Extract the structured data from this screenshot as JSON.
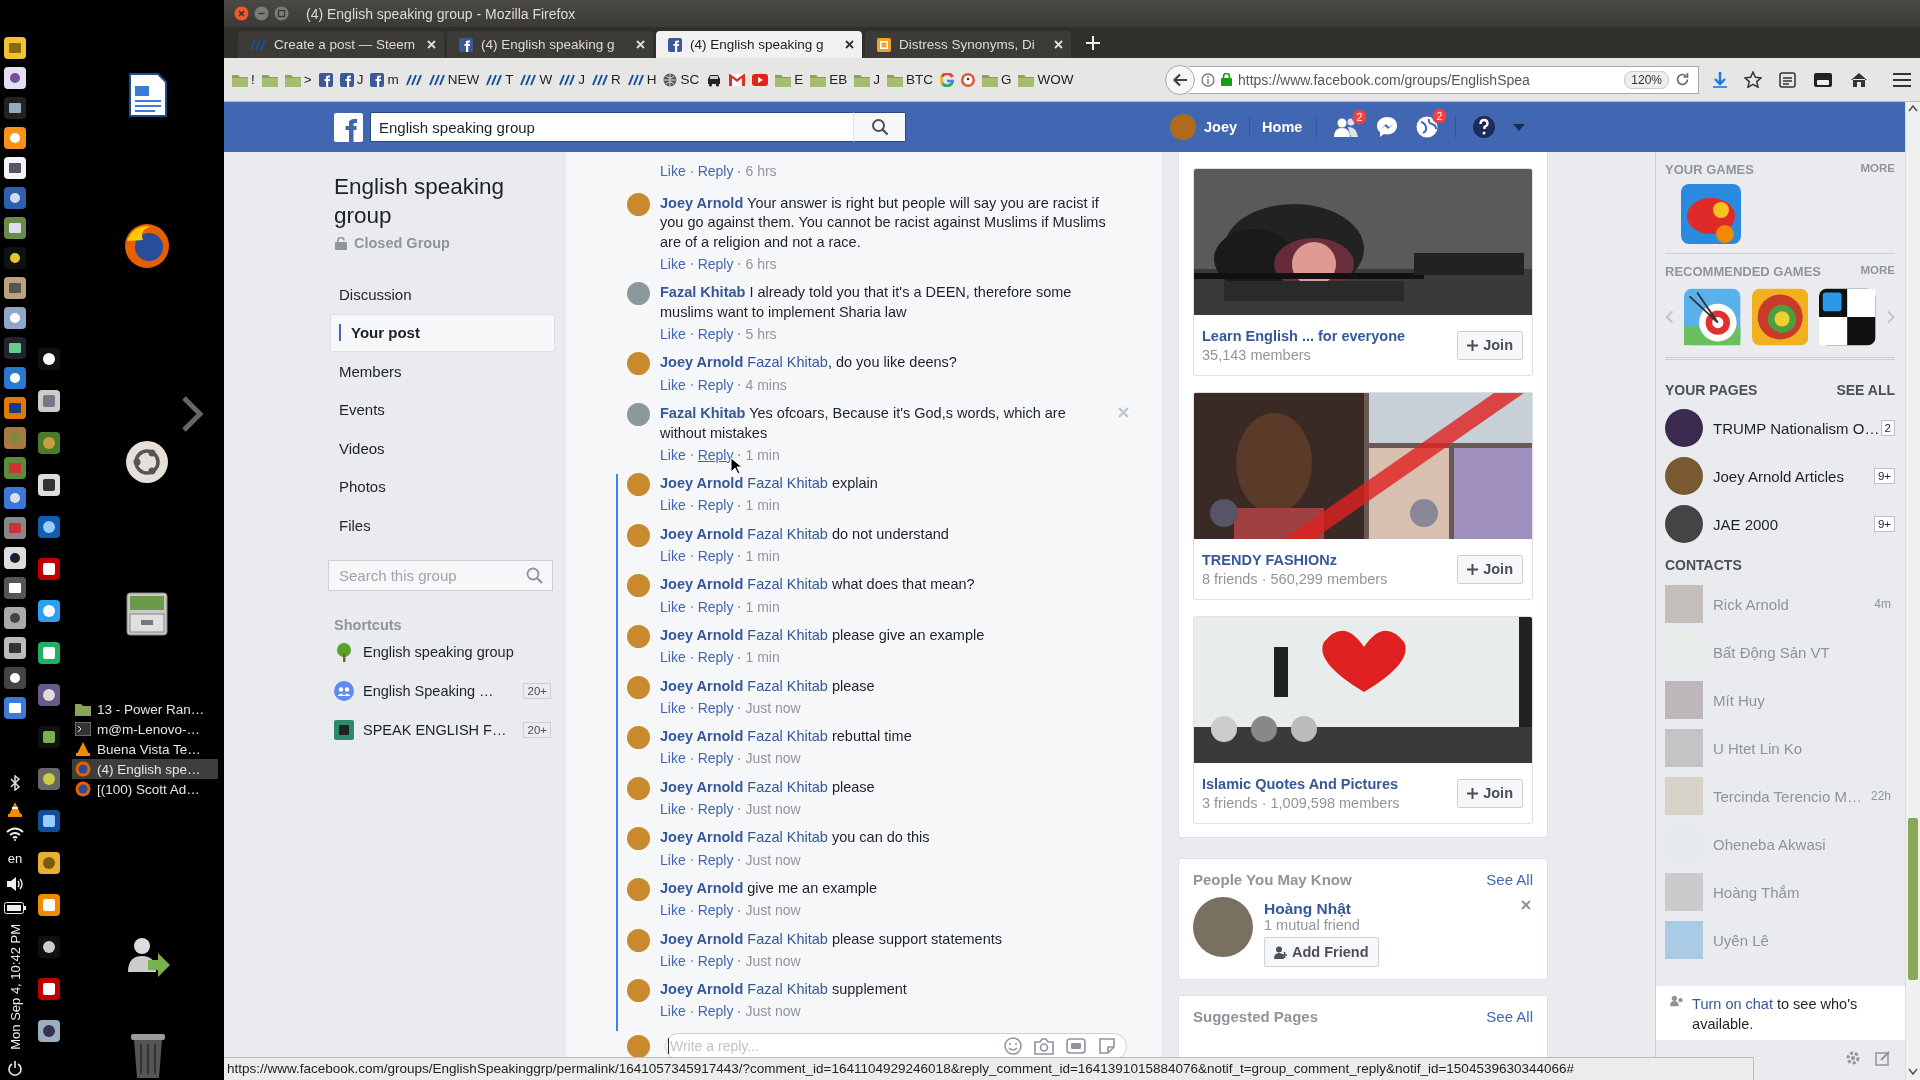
{
  "desktop": {
    "window_list": [
      {
        "title": "13 - Power Ran…",
        "kind": "folder",
        "selected": false
      },
      {
        "title": "m@m-Lenovo-…",
        "kind": "terminal",
        "selected": false
      },
      {
        "title": "Buena Vista Te…",
        "kind": "cone",
        "selected": false
      },
      {
        "title": "(4) English spe…",
        "kind": "firefox",
        "selected": true
      },
      {
        "title": "[(100) Scott Ad…",
        "kind": "firefox",
        "selected": false
      }
    ],
    "keyboard_layout": "en",
    "clock": "Mon Sep 4, 10:42 PM"
  },
  "window": {
    "title": "(4) English speaking group - Mozilla Firefox"
  },
  "tabs": [
    {
      "label": "Create a post — Steem",
      "kind": "steem",
      "selected": false
    },
    {
      "label": "(4) English speaking g",
      "kind": "facebook",
      "selected": false
    },
    {
      "label": "(4) English speaking g",
      "kind": "facebook",
      "selected": true
    },
    {
      "label": "Distress Synonyms, Di",
      "kind": "thesaurus",
      "selected": false
    }
  ],
  "bookmarks": [
    {
      "kind": "folder",
      "label": "!"
    },
    {
      "kind": "folder"
    },
    {
      "kind": "folder",
      "label": ">"
    },
    {
      "kind": "facebook"
    },
    {
      "kind": "facebook",
      "label": "J"
    },
    {
      "kind": "facebook",
      "label": "m"
    },
    {
      "kind": "steem"
    },
    {
      "kind": "steem",
      "label": "NEW"
    },
    {
      "kind": "steem",
      "label": "T"
    },
    {
      "kind": "steem",
      "label": "W"
    },
    {
      "kind": "steem",
      "label": "J"
    },
    {
      "kind": "steem",
      "label": "R"
    },
    {
      "kind": "steem",
      "label": "H"
    },
    {
      "kind": "globe",
      "label": "SC"
    },
    {
      "kind": "car"
    },
    {
      "kind": "mail"
    },
    {
      "kind": "video"
    },
    {
      "kind": "folder",
      "label": "E"
    },
    {
      "kind": "folder",
      "label": "EB"
    },
    {
      "kind": "folder",
      "label": "J"
    },
    {
      "kind": "folder",
      "label": "BTC"
    },
    {
      "kind": "ring"
    },
    {
      "kind": "duck"
    },
    {
      "kind": "folder",
      "label": "G"
    },
    {
      "kind": "folder",
      "label": "WOW"
    }
  ],
  "address_bar": {
    "url": "https://www.facebook.com/groups/EnglishSpea",
    "zoom": "120%"
  },
  "facebook_bar": {
    "search_value": "English speaking group",
    "user": "Joey",
    "home": "Home",
    "friend_requests": "2",
    "notifications": "2"
  },
  "group_nav": {
    "title": "English speaking group",
    "privacy": "Closed Group",
    "items": [
      {
        "label": "Discussion",
        "selected": false
      },
      {
        "label": "Your post",
        "selected": true
      },
      {
        "label": "Members",
        "selected": false
      },
      {
        "label": "Events",
        "selected": false
      },
      {
        "label": "Videos",
        "selected": false
      },
      {
        "label": "Photos",
        "selected": false
      },
      {
        "label": "Files",
        "selected": false
      }
    ],
    "search_placeholder": "Search this group",
    "shortcuts_title": "Shortcuts",
    "shortcuts": [
      {
        "label": "English speaking group",
        "kind": "tree"
      },
      {
        "label": "English Speaking …",
        "kind": "group",
        "badge": "20+"
      },
      {
        "label": "SPEAK ENGLISH F…",
        "kind": "chip",
        "badge": "20+"
      }
    ]
  },
  "comments": [
    {
      "like": "Like",
      "reply": "Reply",
      "time": "6 hrs",
      "new": false,
      "hovered": false
    },
    {
      "author": "Joey Arnold",
      "color": "#c98a2e",
      "text": "Your answer is right but people will say you are racist if you go against them. You cannot be racist against Muslims if Muslims are of a religion and not a race.",
      "like": "Like",
      "reply": "Reply",
      "time": "6 hrs",
      "new": false,
      "hovered": false
    },
    {
      "author": "Fazal Khitab",
      "color": "#8c989c",
      "text": "I already told you that it's a DEEN, therefore some muslims want to implement Sharia law",
      "like": "Like",
      "reply": "Reply",
      "time": "5 hrs",
      "new": false,
      "hovered": false
    },
    {
      "author": "Joey Arnold",
      "color": "#c98a2e",
      "mention": "Fazal Khitab",
      "text": ", do you like deens?",
      "like": "Like",
      "reply": "Reply",
      "time": "4 mins",
      "new": false,
      "hovered": false
    },
    {
      "author": "Fazal Khitab",
      "color": "#8c989c",
      "text": "Yes ofcoars, Because it's God,s words, which are without mistakes",
      "like": "Like",
      "reply": "Reply",
      "time": "1 min",
      "new": false,
      "hovered": true
    },
    {
      "author": "Joey Arnold",
      "color": "#c98a2e",
      "mention": "Fazal Khitab",
      "text": "explain",
      "like": "Like",
      "reply": "Reply",
      "time": "1 min",
      "new": true,
      "hovered": false
    },
    {
      "author": "Joey Arnold",
      "color": "#c98a2e",
      "mention": "Fazal Khitab",
      "text": "do not understand",
      "like": "Like",
      "reply": "Reply",
      "time": "1 min",
      "new": true,
      "hovered": false
    },
    {
      "author": "Joey Arnold",
      "color": "#c98a2e",
      "mention": "Fazal Khitab",
      "text": "what does that mean?",
      "like": "Like",
      "reply": "Reply",
      "time": "1 min",
      "new": true,
      "hovered": false
    },
    {
      "author": "Joey Arnold",
      "color": "#c98a2e",
      "mention": "Fazal Khitab",
      "text": "please give an example",
      "like": "Like",
      "reply": "Reply",
      "time": "1 min",
      "new": true,
      "hovered": false
    },
    {
      "author": "Joey Arnold",
      "color": "#c98a2e",
      "mention": "Fazal Khitab",
      "text": "please",
      "like": "Like",
      "reply": "Reply",
      "time": "Just now",
      "new": true,
      "hovered": false
    },
    {
      "author": "Joey Arnold",
      "color": "#c98a2e",
      "mention": "Fazal Khitab",
      "text": "rebuttal time",
      "like": "Like",
      "reply": "Reply",
      "time": "Just now",
      "new": true,
      "hovered": false
    },
    {
      "author": "Joey Arnold",
      "color": "#c98a2e",
      "mention": "Fazal Khitab",
      "text": "please",
      "like": "Like",
      "reply": "Reply",
      "time": "Just now",
      "new": true,
      "hovered": false
    },
    {
      "author": "Joey Arnold",
      "color": "#c98a2e",
      "mention": "Fazal Khitab",
      "text": "you can do this",
      "like": "Like",
      "reply": "Reply",
      "time": "Just now",
      "new": true,
      "hovered": false
    },
    {
      "author": "Joey Arnold",
      "color": "#c98a2e",
      "text": "give me an example",
      "like": "Like",
      "reply": "Reply",
      "time": "Just now",
      "new": true,
      "hovered": false
    },
    {
      "author": "Joey Arnold",
      "color": "#c98a2e",
      "mention": "Fazal Khitab",
      "text": "please support statements",
      "like": "Like",
      "reply": "Reply",
      "time": "Just now",
      "new": true,
      "hovered": false
    },
    {
      "author": "Joey Arnold",
      "color": "#c98a2e",
      "mention": "Fazal Khitab",
      "text": "supplement",
      "like": "Like",
      "reply": "Reply",
      "time": "Just now",
      "new": true,
      "hovered": false
    }
  ],
  "reply_box": {
    "placeholder": "Write a reply..."
  },
  "suggested_groups": [
    {
      "name": "Learn English ... for everyone",
      "members": "35,143 members",
      "button": "Join"
    },
    {
      "name": "TRENDY FASHIONz",
      "members": "8 friends · 560,299 members",
      "button": "Join"
    },
    {
      "name": "Islamic Quotes And Pictures",
      "members": "3 friends · 1,009,598 members",
      "button": "Join"
    }
  ],
  "people_you_may_know": {
    "title": "People You May Know",
    "see_all": "See All",
    "people": [
      {
        "name": "Hoàng Nhật",
        "mutual": "1 mutual friend",
        "button": "Add Friend"
      }
    ]
  },
  "suggested_pages": {
    "title": "Suggested Pages",
    "see_all": "See All"
  },
  "sidebar": {
    "your_games": {
      "title": "YOUR GAMES",
      "more": "MORE"
    },
    "recommended_games": {
      "title": "RECOMMENDED GAMES",
      "more": "MORE"
    },
    "your_pages": {
      "title": "YOUR PAGES",
      "see_all": "SEE ALL",
      "pages": [
        {
          "name": "TRUMP Nationalism O…",
          "count": "2"
        },
        {
          "name": "Joey Arnold Articles",
          "count": "9+"
        },
        {
          "name": "JAE 2000",
          "count": "9+"
        }
      ]
    },
    "contacts": {
      "title": "CONTACTS",
      "people": [
        {
          "name": "Rick Arnold",
          "time": "4m"
        },
        {
          "name": "Bất Động Sản VT"
        },
        {
          "name": "Mít Huy"
        },
        {
          "name": "U Htet Lin Ko"
        },
        {
          "name": "Tercinda Terencio M…",
          "time": "22h"
        },
        {
          "name": "Oheneba Akwasi"
        },
        {
          "name": "Hoàng Thắm"
        },
        {
          "name": "Uyên Lê"
        }
      ]
    },
    "chat_notice": {
      "link": "Turn on chat",
      "text": "to see who's available."
    }
  },
  "status_url": "https://www.facebook.com/groups/EnglishSpeakinggrp/permalink/1641057345917443/?comment_id=1641104929246018&reply_comment_id=1641391015884076&notif_t=group_comment_reply&notif_id=1504539630344066#"
}
